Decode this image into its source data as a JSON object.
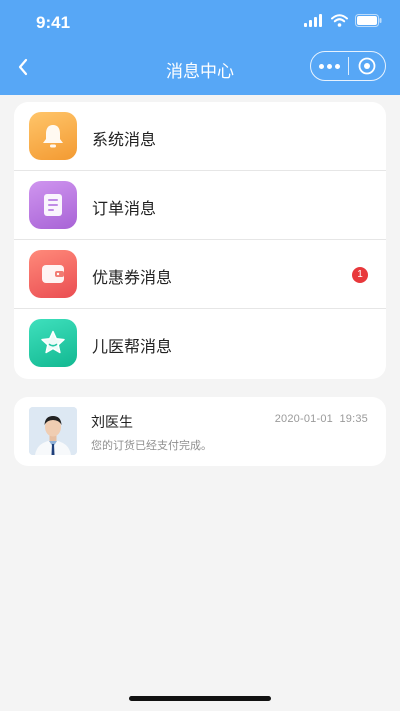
{
  "status_bar": {
    "time": "9:41"
  },
  "nav": {
    "title": "消息中心"
  },
  "categories": [
    {
      "label": "系统消息",
      "icon": "bell-icon",
      "color": "#f9ae4c"
    },
    {
      "label": "订单消息",
      "icon": "document-icon",
      "color": "#b874dc"
    },
    {
      "label": "优惠券消息",
      "icon": "wallet-icon",
      "color": "#f15e5e",
      "badge": "1"
    },
    {
      "label": "儿医帮消息",
      "icon": "star-icon",
      "color": "#22c7a4"
    }
  ],
  "message": {
    "sender": "刘医生",
    "time": "2020-01-01  19:35",
    "preview": "您的订货已经支付完成。"
  },
  "colors": {
    "header": "#57a7f6",
    "badge": "#e8383b"
  }
}
